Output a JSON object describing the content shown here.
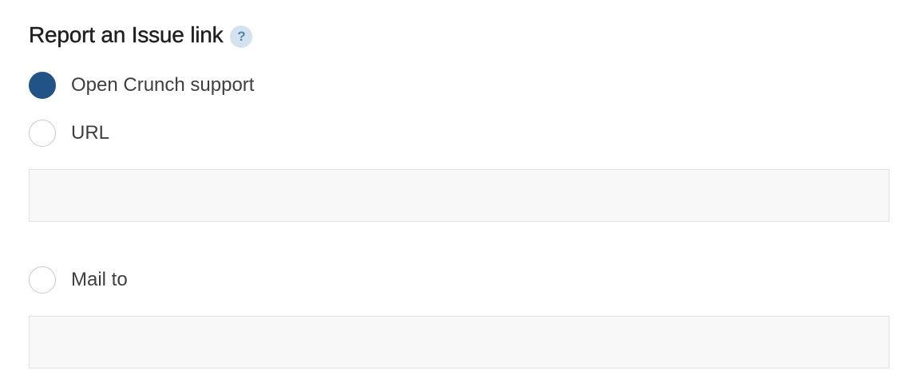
{
  "report_issue": {
    "title": "Report an Issue link",
    "help_icon_glyph": "?",
    "options": [
      {
        "label": "Open Crunch support",
        "checked": true
      },
      {
        "label": "URL",
        "checked": false
      },
      {
        "label": "Mail to",
        "checked": false
      }
    ],
    "url_input": {
      "value": "",
      "placeholder": ""
    },
    "mailto_input": {
      "value": "",
      "placeholder": ""
    }
  },
  "colors": {
    "radio_checked": "#215386",
    "help_icon_bg": "#d3e2ee",
    "help_icon_fg": "#4d86b5",
    "input_bg": "#f8f8f8"
  }
}
